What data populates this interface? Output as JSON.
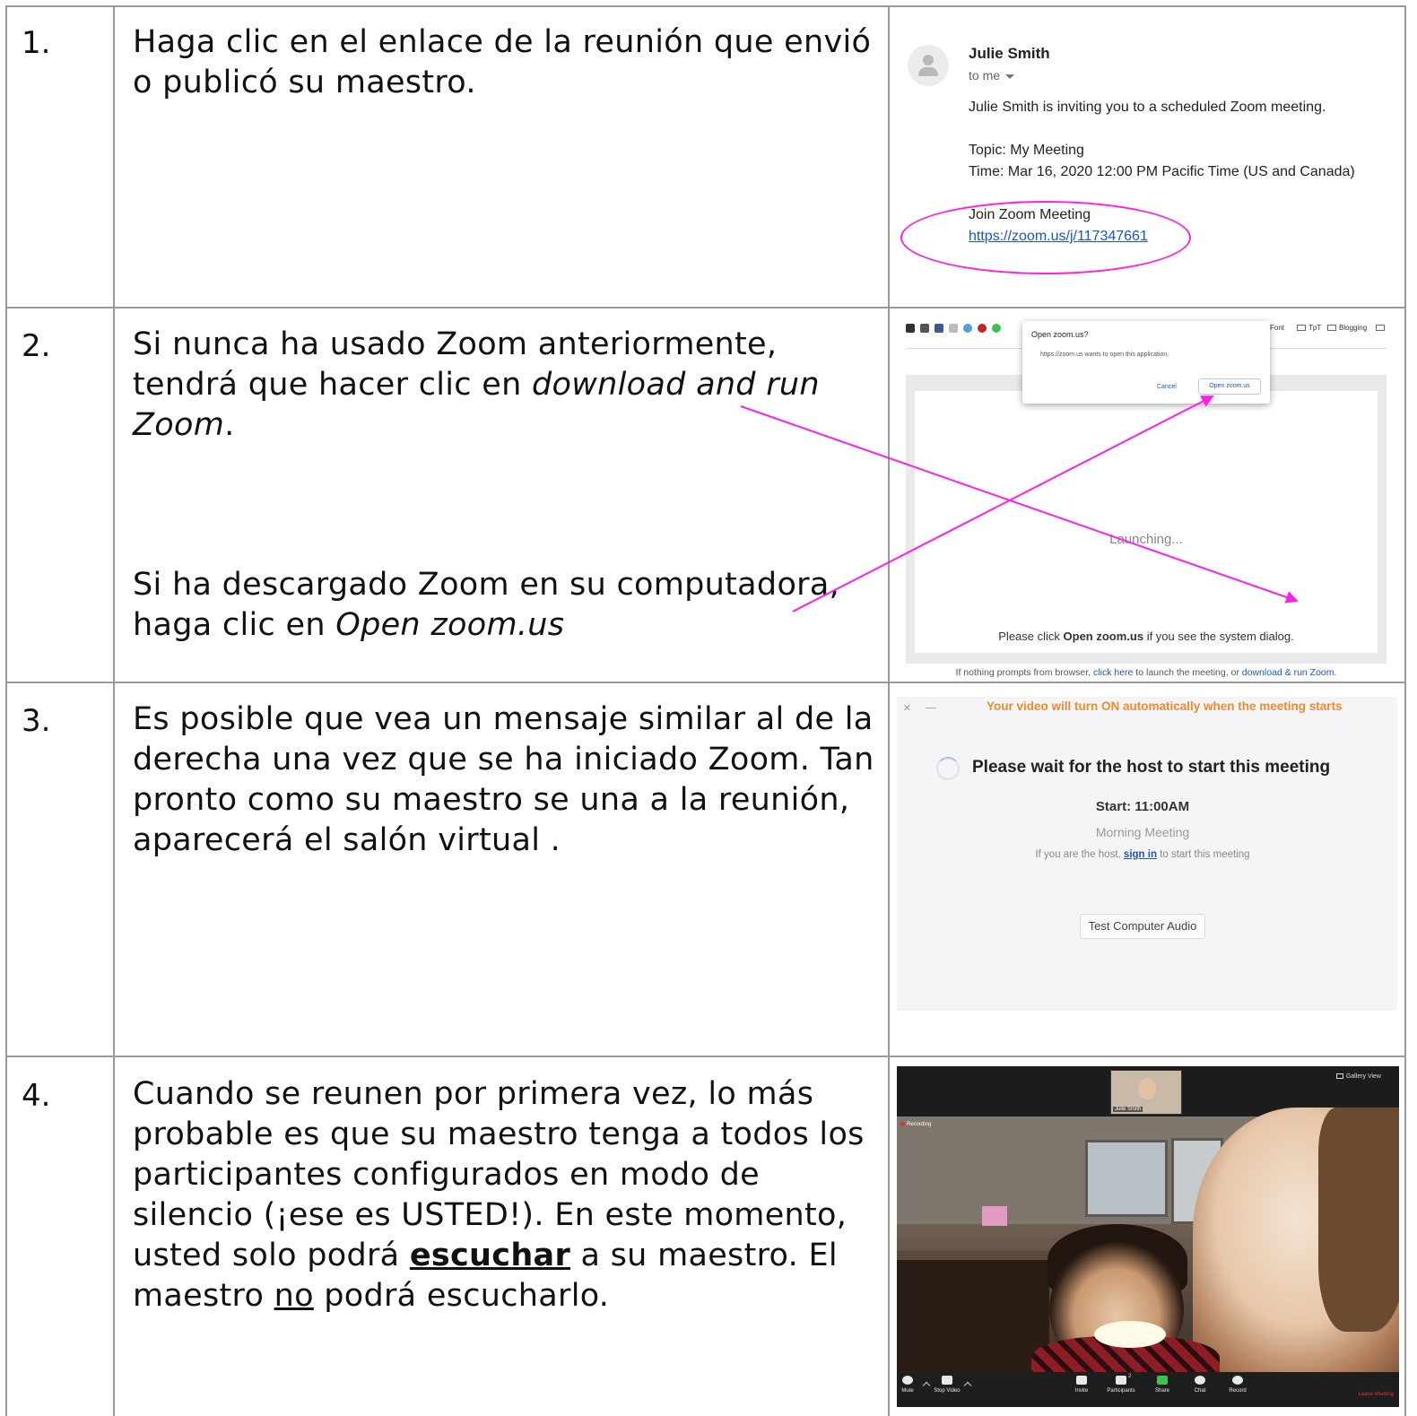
{
  "steps": [
    {
      "number": "1.",
      "text": "Haga clic en el enlace de la reunión que envió o publicó su maestro."
    },
    {
      "number": "2.",
      "text_a_prefix": "Si nunca ha usado Zoom anteriormente, tendrá que hacer clic en ",
      "text_a_italic": "download and run Zoom",
      "text_a_suffix": ".",
      "text_b_prefix": "Si ha descargado Zoom en su computadora, haga clic en ",
      "text_b_italic": "Open zoom.us"
    },
    {
      "number": "3.",
      "text": "Es posible que vea un mensaje similar al de la derecha una vez que se ha iniciado Zoom. Tan pronto como su maestro se una a la reunión, aparecerá el salón virtual ."
    },
    {
      "number": "4.",
      "text_p1": "Cuando se reunen por primera vez, lo más probable es que su maestro tenga a todos los participantes configurados en modo de silencio (¡ese es USTED!). En este momento, usted solo podrá ",
      "text_bold_u": "escuchar",
      "text_p2": " a su maestro. El maestro ",
      "text_u": "no",
      "text_p3": " podrá escucharlo."
    }
  ],
  "email": {
    "sender": "Julie Smith",
    "to": "to me",
    "invite": "Julie Smith is inviting you to a scheduled Zoom meeting.",
    "topic": "Topic: My Meeting",
    "time": "Time: Mar 16, 2020 12:00 PM Pacific Time (US and Canada)",
    "join": "Join Zoom Meeting",
    "link": "https://zoom.us/j/117347661"
  },
  "browser": {
    "bookmarks": [
      "Font",
      "TpT",
      "Blogging"
    ],
    "dialog_title": "Open zoom.us?",
    "dialog_message": "https://zoom.us wants to open this application.",
    "cancel": "Cancel",
    "open": "Open zoom.us",
    "launching": "Launching...",
    "please_pre": "Please click ",
    "please_bold": "Open zoom.us",
    "please_post": " if you see the system dialog.",
    "nothing_pre": "If nothing prompts from browser, ",
    "nothing_link1": "click here",
    "nothing_mid": " to launch the meeting, or ",
    "nothing_link2": "download & run Zoom",
    "nothing_post": "."
  },
  "waiting": {
    "warning": "Your video will turn ON automatically when the meeting starts",
    "title": "Please wait for the host to start this meeting",
    "start": "Start: 11:00AM",
    "meeting": "Morning Meeting",
    "host_pre": "If you are the host, ",
    "host_link": "sign in",
    "host_post": " to start this meeting",
    "test_audio": "Test Computer Audio",
    "close": "×"
  },
  "video": {
    "thumb_label": "Julie Smith",
    "gallery": "Gallery View",
    "recording": "Recording",
    "toolbar": [
      "Mute",
      "Stop Video",
      "Invite",
      "Participants",
      "Share",
      "Chat",
      "Record"
    ],
    "participants_count": "2",
    "leave": "Leave Meeting"
  },
  "colors": {
    "annotation": "#ff1fe6",
    "link": "#1a55c9",
    "warning": "#f08a2c",
    "grid": "#9a9a9a"
  }
}
